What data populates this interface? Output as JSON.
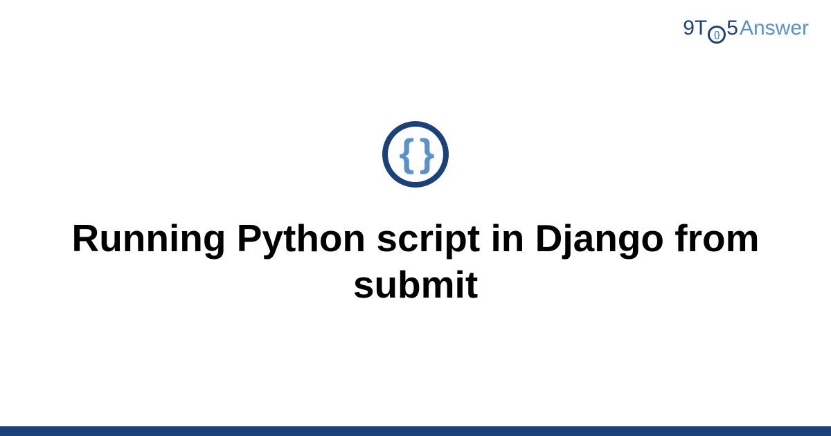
{
  "brand": {
    "part1": "9T",
    "inner": "{}",
    "part3": "5",
    "part4": "Answer"
  },
  "category_icon_glyph": "{ }",
  "title": "Running Python script in Django from submit",
  "colors": {
    "primary_dark": "#1a4278",
    "primary_light": "#5a91c9"
  }
}
